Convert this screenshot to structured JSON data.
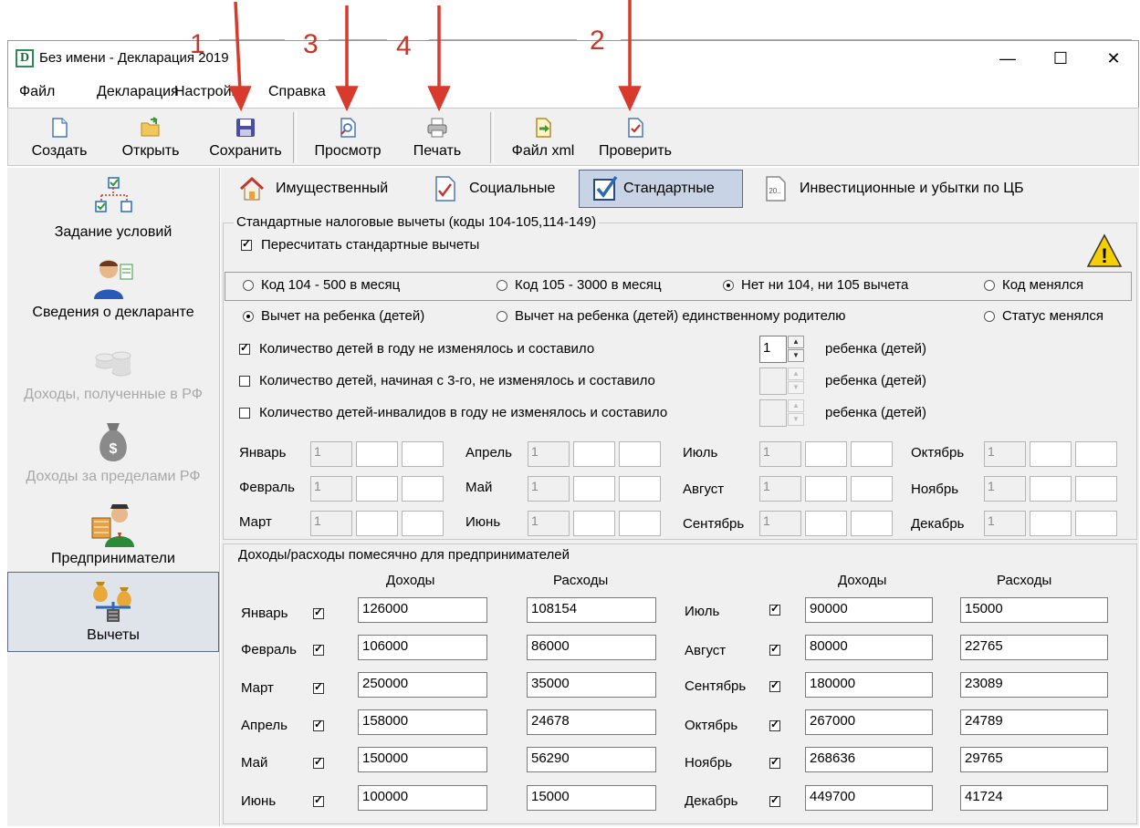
{
  "annotations": [
    "1",
    "3",
    "4",
    "2"
  ],
  "window": {
    "icon_letter": "D",
    "title": "Без имени - Декларация 2019",
    "minimize": "—",
    "maximize": "☐",
    "close": "✕"
  },
  "menu": [
    "Файл",
    "Декларация",
    "Настройки",
    "Справка"
  ],
  "toolbar": {
    "create": "Создать",
    "open": "Открыть",
    "save": "Сохранить",
    "preview": "Просмотр",
    "print": "Печать",
    "xml": "Файл xml",
    "check": "Проверить"
  },
  "nav": [
    {
      "label": "Задание условий",
      "icon": "conditions-icon",
      "enabled": true
    },
    {
      "label": "Сведения о декларанте",
      "icon": "person-icon",
      "enabled": true
    },
    {
      "label": "Доходы, полученные в РФ",
      "icon": "coins-icon",
      "enabled": false
    },
    {
      "label": "Доходы за пределами РФ",
      "icon": "money-bag-icon",
      "enabled": false
    },
    {
      "label": "Предприниматели",
      "icon": "entrepreneur-icon",
      "enabled": true
    },
    {
      "label": "Вычеты",
      "icon": "deductions-icon",
      "enabled": true,
      "active": true
    }
  ],
  "tabs": [
    {
      "label": "Имущественный",
      "icon": "house-icon"
    },
    {
      "label": "Социальные",
      "icon": "document-check-icon"
    },
    {
      "label": "Стандартные",
      "icon": "checkbox-icon",
      "active": true
    },
    {
      "label": "Инвестиционные и убытки по ЦБ",
      "icon": "document-20-icon"
    }
  ],
  "standard": {
    "group_title": "Стандартные налоговые вычеты (коды 104-105,114-149)",
    "recalc_label": "Пересчитать стандартные вычеты",
    "recalc_checked": true,
    "warning_icon": "!",
    "code_radios": [
      {
        "label": "Код 104 - 500 в месяц",
        "checked": false
      },
      {
        "label": "Код 105 - 3000 в месяц",
        "checked": false
      },
      {
        "label": "Нет ни 104, ни 105 вычета",
        "checked": true
      },
      {
        "label": "Код менялся",
        "checked": false
      }
    ],
    "child_radios": [
      {
        "label": "Вычет на ребенка (детей)",
        "checked": true
      },
      {
        "label": "Вычет на ребенка (детей) единственному родителю",
        "checked": false
      },
      {
        "label": "Статус менялся",
        "checked": false
      }
    ],
    "child_rows": [
      {
        "label": "Количество детей в году не изменялось и составило",
        "checked": true,
        "value": "1",
        "suffix": "ребенка (детей)"
      },
      {
        "label": "Количество детей, начиная с 3-го, не изменялось и составило",
        "checked": false,
        "value": "",
        "suffix": "ребенка (детей)"
      },
      {
        "label": "Количество детей-инвалидов в году не изменялось и составило",
        "checked": false,
        "value": "",
        "suffix": "ребенка (детей)"
      }
    ],
    "spin_up": "▲",
    "spin_down": "▼",
    "months_grid": [
      {
        "name": "Январь",
        "value": "1"
      },
      {
        "name": "Февраль",
        "value": "1"
      },
      {
        "name": "Март",
        "value": "1"
      },
      {
        "name": "Апрель",
        "value": "1"
      },
      {
        "name": "Май",
        "value": "1"
      },
      {
        "name": "Июнь",
        "value": "1"
      },
      {
        "name": "Июль",
        "value": "1"
      },
      {
        "name": "Август",
        "value": "1"
      },
      {
        "name": "Сентябрь",
        "value": "1"
      },
      {
        "name": "Октябрь",
        "value": "1"
      },
      {
        "name": "Ноябрь",
        "value": "1"
      },
      {
        "name": "Декабрь",
        "value": "1"
      }
    ]
  },
  "monthly": {
    "group_title": "Доходы/расходы помесячно для предпринимателей",
    "income_header": "Доходы",
    "expense_header": "Расходы",
    "rows": [
      {
        "month": "Январь",
        "checked": true,
        "income": "126000",
        "expense": "108154"
      },
      {
        "month": "Февраль",
        "checked": true,
        "income": "106000",
        "expense": "86000"
      },
      {
        "month": "Март",
        "checked": true,
        "income": "250000",
        "expense": "35000"
      },
      {
        "month": "Апрель",
        "checked": true,
        "income": "158000",
        "expense": "24678"
      },
      {
        "month": "Май",
        "checked": true,
        "income": "150000",
        "expense": "56290"
      },
      {
        "month": "Июнь",
        "checked": true,
        "income": "100000",
        "expense": "15000"
      },
      {
        "month": "Июль",
        "checked": true,
        "income": "90000",
        "expense": "15000"
      },
      {
        "month": "Август",
        "checked": true,
        "income": "80000",
        "expense": "22765"
      },
      {
        "month": "Сентябрь",
        "checked": true,
        "income": "180000",
        "expense": "23089"
      },
      {
        "month": "Октябрь",
        "checked": true,
        "income": "267000",
        "expense": "24789"
      },
      {
        "month": "Ноябрь",
        "checked": true,
        "income": "268636",
        "expense": "29765"
      },
      {
        "month": "Декабрь",
        "checked": true,
        "income": "449700",
        "expense": "41724"
      }
    ]
  },
  "colors": {
    "accent": "#c0392b",
    "window_bg": "#f0f0f0",
    "active_tab": "#c8d4e6"
  }
}
